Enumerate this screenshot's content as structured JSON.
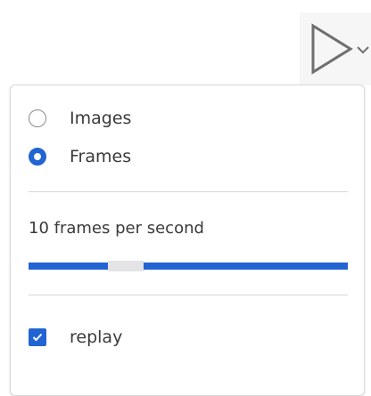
{
  "colors": {
    "accent": "#2264d1",
    "text": "#3a3a3a",
    "divider": "#d6d6d6",
    "slider_thumb": "#e4e4e6"
  },
  "play_toggle": {
    "icon": "play-icon",
    "chevron_icon": "chevron-down-icon"
  },
  "mode": {
    "selected": "Frames",
    "options": [
      {
        "label": "Images",
        "checked": false
      },
      {
        "label": "Frames",
        "checked": true
      }
    ]
  },
  "rate": {
    "label": "10 frames per second",
    "slider_value_fraction": 0.28
  },
  "replay": {
    "label": "replay",
    "checked": true
  }
}
